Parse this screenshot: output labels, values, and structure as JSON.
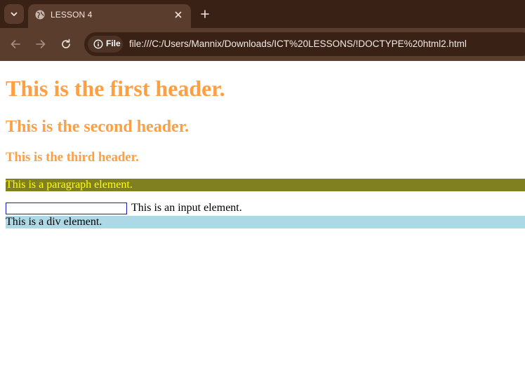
{
  "browser": {
    "tab": {
      "title": "LESSON 4"
    },
    "address_bar": {
      "site_chip_label": "File",
      "url": "file:///C:/Users/Mannix/Downloads/ICT%20LESSONS/!DOCTYPE%20html2.html"
    },
    "icons": {
      "tab_search": "chevron-down-icon",
      "tab_favicon": "globe-icon",
      "tab_close": "close-icon",
      "new_tab": "plus-icon",
      "back": "arrow-left-icon",
      "forward": "arrow-right-icon",
      "reload": "reload-icon",
      "site_info": "info-icon"
    },
    "colors": {
      "tabstrip": "#3a2116",
      "toolbar": "#5b3d2d"
    }
  },
  "page": {
    "h1": "This is the first header.",
    "h2": "This is the second header.",
    "h3": "This is the third header.",
    "paragraph": "This is a paragraph element.",
    "input": {
      "value": "",
      "caption": "This is an input element."
    },
    "div": "This is a div element.",
    "colors": {
      "headers": "#ff9f43",
      "paragraph_bg": "#808020",
      "paragraph_text": "#ffff00",
      "div_bg": "#add8e6",
      "input_border": "#1a1acc"
    }
  }
}
